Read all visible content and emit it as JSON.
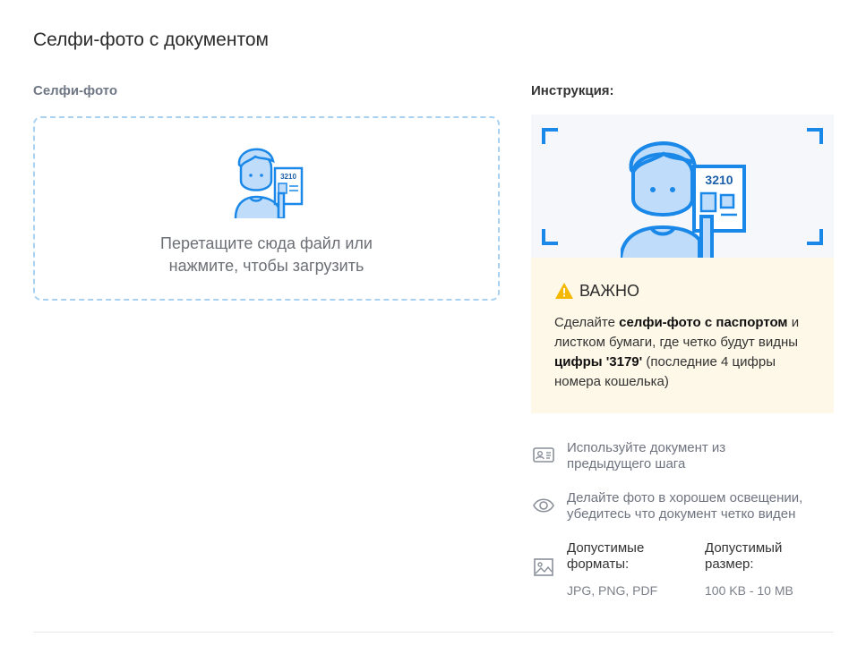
{
  "page": {
    "title": "Селфи-фото с документом"
  },
  "upload": {
    "label": "Селфи-фото",
    "drop_line1": "Перетащите сюда файл или",
    "drop_line2": "нажмите, чтобы загрузить",
    "illustration_number": "3210"
  },
  "instruction": {
    "label": "Инструкция:",
    "illustration_number": "3210",
    "important_title": "ВАЖНО",
    "text_part1": "Сделайте ",
    "text_bold1": "селфи-фото с паспортом",
    "text_part2": " и листком бумаги, где четко будут видны ",
    "text_bold2": "цифры '3179'",
    "text_part3": " (последние 4 цифры номера кошелька)"
  },
  "tips": {
    "tip1": "Используйте документ из предыдущего шага",
    "tip2": "Делайте фото в хорошем освещении, убедитесь что документ четко виден",
    "formats_label": "Допустимые форматы:",
    "formats_value": "JPG, PNG, PDF",
    "size_label": "Допустимый размер:",
    "size_value": "100 KB - 10 MB"
  },
  "icons": {
    "warning": "warning-icon",
    "id_card": "id-card-icon",
    "eye": "eye-icon",
    "image": "image-icon"
  },
  "colors": {
    "accent": "#1a88e8",
    "dropzone_border": "#a9d2f2",
    "warning_bg": "#fef8e8",
    "warning_icon": "#f5b800",
    "illustration_skin": "#bfdcfa"
  }
}
